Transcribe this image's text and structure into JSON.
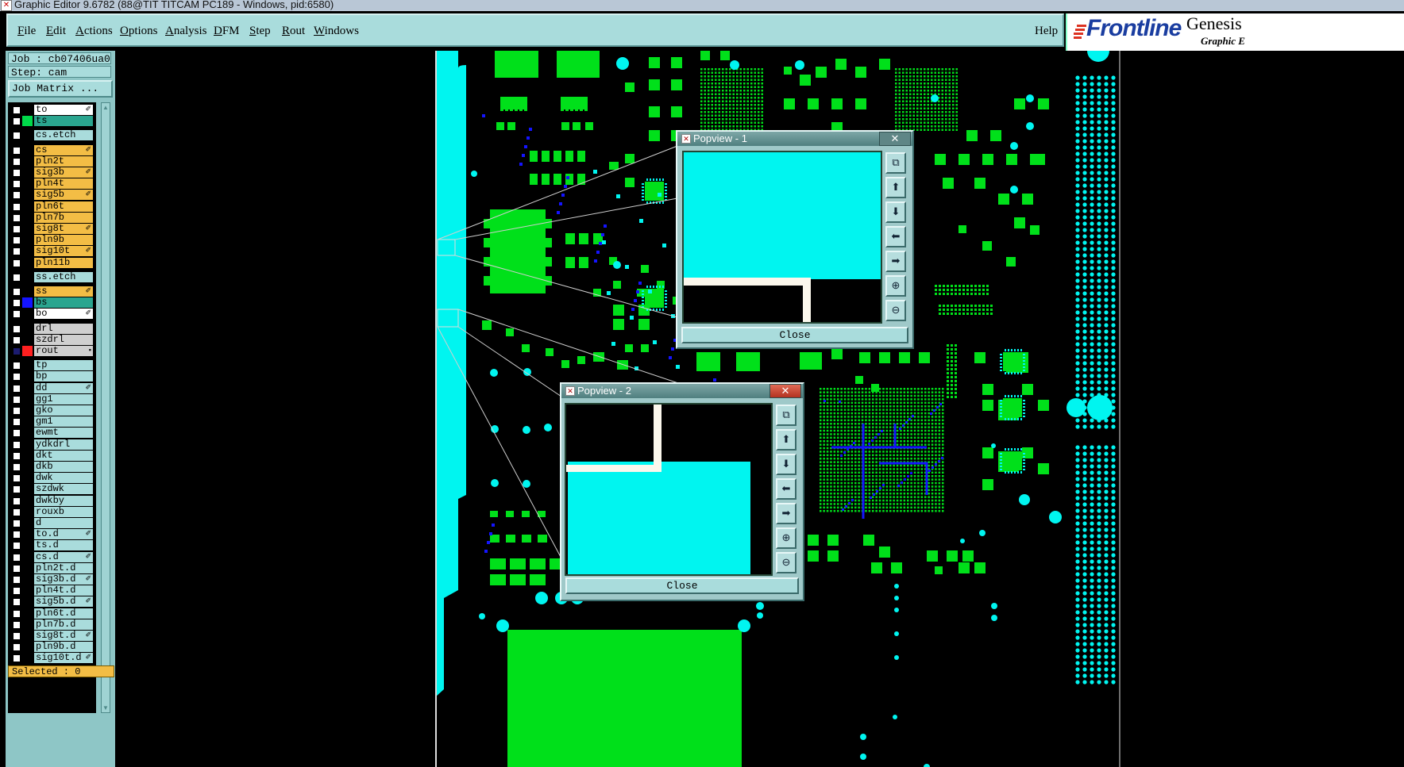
{
  "window": {
    "title": "Graphic Editor 9.6782 (88@TIT TITCAM PC189 - Windows, pid:6580)"
  },
  "menu": [
    {
      "label": "File",
      "ul": "F",
      "rest": "ile"
    },
    {
      "label": "Edit",
      "ul": "E",
      "rest": "dit"
    },
    {
      "label": "Actions",
      "ul": "A",
      "rest": "ctions"
    },
    {
      "label": "Options",
      "ul": "O",
      "rest": "ptions"
    },
    {
      "label": "Analysis",
      "ul": "A",
      "rest": "nalysis"
    },
    {
      "label": "DFM",
      "ul": "D",
      "rest": "FM"
    },
    {
      "label": "Step",
      "ul": "S",
      "rest": "tep"
    },
    {
      "label": "Rout",
      "ul": "R",
      "rest": "out"
    },
    {
      "label": "Windows",
      "ul": "W",
      "rest": "indows"
    }
  ],
  "help": "Help",
  "logo": {
    "brand": "Frontline",
    "product": "Genesis",
    "sub": "Graphic E"
  },
  "panel": {
    "job": "Job : cb07406ua0",
    "step": "Step: cam",
    "job_matrix": "Job Matrix ...",
    "selected": "Selected : 0"
  },
  "colors": {
    "cyan_layer": "#a9dcdc",
    "orange_layer": "#f3bd45",
    "teal_layer": "#2aa58f",
    "gray_layer": "#cfcfcf",
    "pcb_green": "#00e01a",
    "pcb_cyan": "#00f5f0",
    "pcb_blue": "#1414ff"
  },
  "layers": [
    {
      "name": "to",
      "type": "white",
      "sw": "",
      "mark": "✐"
    },
    {
      "name": "ts",
      "type": "teal",
      "sw": "#00d94a",
      "mark": ""
    },
    {
      "name": "cs.etch",
      "type": "cyan",
      "sw": "",
      "mark": "",
      "gap": 1
    },
    {
      "name": "cs",
      "type": "orange",
      "sw": "",
      "mark": "✐",
      "gap": 1
    },
    {
      "name": "pln2t",
      "type": "orange",
      "sw": "",
      "mark": ""
    },
    {
      "name": "sig3b",
      "type": "orange",
      "sw": "",
      "mark": "✐"
    },
    {
      "name": "pln4t",
      "type": "orange",
      "sw": "",
      "mark": ""
    },
    {
      "name": "sig5b",
      "type": "orange",
      "sw": "",
      "mark": "✐"
    },
    {
      "name": "pln6t",
      "type": "orange",
      "sw": "",
      "mark": ""
    },
    {
      "name": "pln7b",
      "type": "orange",
      "sw": "",
      "mark": ""
    },
    {
      "name": "sig8t",
      "type": "orange",
      "sw": "",
      "mark": "✐"
    },
    {
      "name": "pln9b",
      "type": "orange",
      "sw": "",
      "mark": ""
    },
    {
      "name": "sig10t",
      "type": "orange",
      "sw": "",
      "mark": "✐"
    },
    {
      "name": "pln11b",
      "type": "orange",
      "sw": "",
      "mark": ""
    },
    {
      "name": "ss.etch",
      "type": "cyan",
      "sw": "",
      "mark": "",
      "gap": 1
    },
    {
      "name": "ss",
      "type": "orange",
      "sw": "",
      "mark": "✐",
      "gap": 1
    },
    {
      "name": "bs",
      "type": "teal",
      "sw": "#1414ff",
      "mark": ""
    },
    {
      "name": "bo",
      "type": "white",
      "sw": "",
      "mark": "✐"
    },
    {
      "name": "drl",
      "type": "gray",
      "sw": "",
      "mark": "",
      "gap": 1
    },
    {
      "name": "szdrl",
      "type": "gray",
      "sw": "",
      "mark": ""
    },
    {
      "name": "rout",
      "type": "gray",
      "sw": "#ff2020",
      "mark": "▪",
      "sel": 1
    },
    {
      "name": "tp",
      "type": "cyan",
      "sw": "",
      "mark": "",
      "gap": 1
    },
    {
      "name": "bp",
      "type": "cyan",
      "sw": "",
      "mark": ""
    },
    {
      "name": "dd",
      "type": "cyan",
      "sw": "",
      "mark": "✐"
    },
    {
      "name": "gg1",
      "type": "cyan",
      "sw": "",
      "mark": ""
    },
    {
      "name": "gko",
      "type": "cyan",
      "sw": "",
      "mark": ""
    },
    {
      "name": "gm1",
      "type": "cyan",
      "sw": "",
      "mark": ""
    },
    {
      "name": "ewmt",
      "type": "cyan",
      "sw": "",
      "mark": ""
    },
    {
      "name": "ydkdrl",
      "type": "cyan",
      "sw": "",
      "mark": ""
    },
    {
      "name": "dkt",
      "type": "cyan",
      "sw": "",
      "mark": ""
    },
    {
      "name": "dkb",
      "type": "cyan",
      "sw": "",
      "mark": ""
    },
    {
      "name": "dwk",
      "type": "cyan",
      "sw": "",
      "mark": ""
    },
    {
      "name": "szdwk",
      "type": "cyan",
      "sw": "",
      "mark": ""
    },
    {
      "name": "dwkby",
      "type": "cyan",
      "sw": "",
      "mark": ""
    },
    {
      "name": "rouxb",
      "type": "cyan",
      "sw": "",
      "mark": ""
    },
    {
      "name": "d",
      "type": "cyan",
      "sw": "",
      "mark": ""
    },
    {
      "name": "to.d",
      "type": "cyan",
      "sw": "",
      "mark": "✐"
    },
    {
      "name": "ts.d",
      "type": "cyan",
      "sw": "",
      "mark": ""
    },
    {
      "name": "cs.d",
      "type": "cyan",
      "sw": "",
      "mark": "✐"
    },
    {
      "name": "pln2t.d",
      "type": "cyan",
      "sw": "",
      "mark": ""
    },
    {
      "name": "sig3b.d",
      "type": "cyan",
      "sw": "",
      "mark": "✐"
    },
    {
      "name": "pln4t.d",
      "type": "cyan",
      "sw": "",
      "mark": ""
    },
    {
      "name": "sig5b.d",
      "type": "cyan",
      "sw": "",
      "mark": "✐"
    },
    {
      "name": "pln6t.d",
      "type": "cyan",
      "sw": "",
      "mark": ""
    },
    {
      "name": "pln7b.d",
      "type": "cyan",
      "sw": "",
      "mark": ""
    },
    {
      "name": "sig8t.d",
      "type": "cyan",
      "sw": "",
      "mark": "✐"
    },
    {
      "name": "pln9b.d",
      "type": "cyan",
      "sw": "",
      "mark": ""
    },
    {
      "name": "sig10t.d",
      "type": "cyan",
      "sw": "",
      "mark": "✐"
    }
  ],
  "popviews": [
    {
      "title": "Popview - 1",
      "close_label": "Close",
      "x_glyph": "✕"
    },
    {
      "title": "Popview - 2",
      "close_label": "Close",
      "x_glyph": "✕"
    }
  ],
  "popview_tools": [
    "zoom-fit-icon",
    "pan-up-icon",
    "pan-down-icon",
    "pan-left-icon",
    "pan-right-icon",
    "zoom-in-icon",
    "zoom-out-icon"
  ]
}
